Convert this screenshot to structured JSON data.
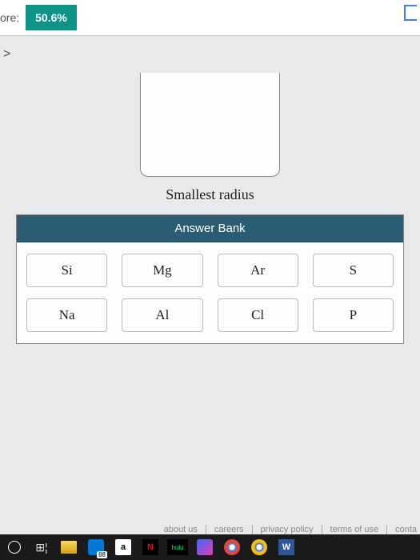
{
  "header": {
    "score_label": "ore:",
    "score_value": "50.6%"
  },
  "nav": {
    "chevron": ">"
  },
  "prompt": {
    "smallest_label": "Smallest radius"
  },
  "answer_bank": {
    "title": "Answer Bank",
    "row1": [
      "Si",
      "Mg",
      "Ar",
      "S"
    ],
    "row2": [
      "Na",
      "Al",
      "Cl",
      "P"
    ]
  },
  "footer": {
    "links": [
      "about us",
      "careers",
      "privacy policy",
      "terms of use",
      "conta"
    ]
  },
  "taskbar": {
    "edge_badge": "88",
    "amazon": "a",
    "netflix": "N",
    "hulu": "hulu",
    "word": "W"
  }
}
